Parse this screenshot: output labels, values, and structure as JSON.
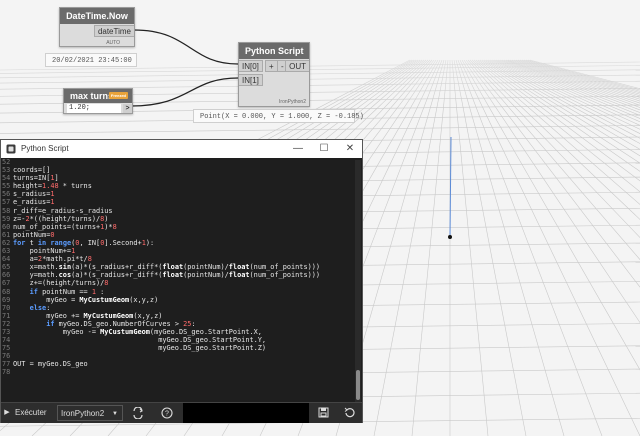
{
  "nodes": {
    "datetime": {
      "title": "DateTime.Now",
      "output": "dateTime",
      "lacing": "AUTO",
      "preview": "20/02/2021 23:45:00"
    },
    "maxturns": {
      "title": "max turns",
      "badge": "Freezed",
      "value": "1.20;",
      "output_symbol": ">"
    },
    "python": {
      "title": "Python Script",
      "inputs": [
        "IN[0]",
        "IN[1]"
      ],
      "add": "+",
      "remove": "-",
      "output": "OUT",
      "engine": "IronPython2",
      "preview": "Point(X = 0.000, Y = 1.000, Z = -0.185)"
    }
  },
  "editor": {
    "title": "Python Script",
    "window_buttons": {
      "minimize": "—",
      "maximize": "☐",
      "close": "✕"
    },
    "code_lines": [
      {
        "n": "52",
        "t": ""
      },
      {
        "n": "53",
        "t": "coords=[]"
      },
      {
        "n": "54",
        "t": "turns=IN[1]"
      },
      {
        "n": "55",
        "t": "height=1.48 * turns"
      },
      {
        "n": "56",
        "t": "s_radius=1"
      },
      {
        "n": "57",
        "t": "e_radius=1"
      },
      {
        "n": "58",
        "t": "r_diff=e_radius-s_radius"
      },
      {
        "n": "59",
        "t": "z=-2*((height/turns)/8)"
      },
      {
        "n": "60",
        "t": "num_of_points=(turns+1)*8"
      },
      {
        "n": "61",
        "t": "pointNum=0"
      },
      {
        "n": "62",
        "t": "for t in range(0, IN[0].Second+1):"
      },
      {
        "n": "63",
        "t": "    pointNum+=1"
      },
      {
        "n": "64",
        "t": "    a=2*math.pi*t/8"
      },
      {
        "n": "65",
        "t": "    x=math.sin(a)*(s_radius+r_diff*(float(pointNum)/float(num_of_points)))"
      },
      {
        "n": "66",
        "t": "    y=math.cos(a)*(s_radius+r_diff*(float(pointNum)/float(num_of_points)))"
      },
      {
        "n": "67",
        "t": "    z+=(height/turns)/8"
      },
      {
        "n": "68",
        "t": "    if pointNum == 1 :"
      },
      {
        "n": "69",
        "t": "        myGeo = MyCustumGeom(x,y,z)"
      },
      {
        "n": "70",
        "t": "    else:"
      },
      {
        "n": "71",
        "t": "        myGeo += MyCustumGeom(x,y,z)"
      },
      {
        "n": "72",
        "t": "        if myGeo.DS_geo.NumberOfCurves > 25:"
      },
      {
        "n": "73",
        "t": "            myGeo -= MyCustumGeom(myGeo.DS_geo.StartPoint.X,"
      },
      {
        "n": "74",
        "t": "                                   myGeo.DS_geo.StartPoint.Y,"
      },
      {
        "n": "75",
        "t": "                                   myGeo.DS_geo.StartPoint.Z)"
      },
      {
        "n": "76",
        "t": ""
      },
      {
        "n": "77",
        "t": "OUT = myGeo.DS_geo"
      },
      {
        "n": "78",
        "t": ""
      }
    ],
    "toolbar": {
      "run": "Exécuter",
      "engine": "IronPython2",
      "engine_arrow": "▼"
    }
  },
  "icons": [
    "python-icon",
    "run-icon",
    "engine-dropdown-icon",
    "migration-icon",
    "help-icon",
    "save-icon",
    "revert-icon"
  ],
  "colors": {
    "keyword": "#5b9cff",
    "number": "#ff6b6b",
    "code_bg": "#1e1e1e",
    "node_header": "#6b6b6b",
    "wire": "#222222",
    "geometry_line": "#5b8ad6"
  }
}
